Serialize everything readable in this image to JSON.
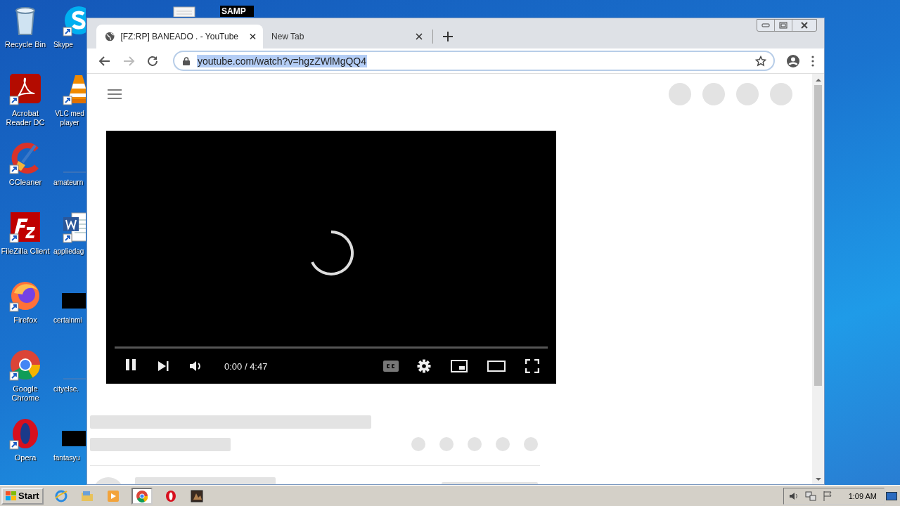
{
  "desktop": {
    "icons": [
      {
        "label": "Recycle Bin",
        "kind": "recycle",
        "shortcut": false
      },
      {
        "label": "Acrobat Reader DC",
        "kind": "acrobat",
        "shortcut": true
      },
      {
        "label": "CCleaner",
        "kind": "ccleaner",
        "shortcut": true
      },
      {
        "label": "FileZilla Client",
        "kind": "filezilla",
        "shortcut": true
      },
      {
        "label": "Firefox",
        "kind": "firefox",
        "shortcut": true
      },
      {
        "label": "Google Chrome",
        "kind": "chrome",
        "shortcut": true
      },
      {
        "label": "Opera",
        "kind": "opera",
        "shortcut": true
      }
    ],
    "partly_hidden_icons": [
      {
        "label": "Skype",
        "kind": "skype",
        "shortcut": true
      },
      {
        "label": "VLC med player",
        "kind": "vlc",
        "shortcut": true
      },
      {
        "label": "amateurn",
        "kind": "blank",
        "shortcut": false
      },
      {
        "label": "appliedag",
        "kind": "word",
        "shortcut": true
      },
      {
        "label": "certainmi",
        "kind": "redacted",
        "shortcut": false
      },
      {
        "label": "cityelse.",
        "kind": "blank",
        "shortcut": false
      },
      {
        "label": "fantasyu",
        "kind": "redacted",
        "shortcut": false
      }
    ],
    "top_icons": [
      {
        "kind": "document"
      },
      {
        "kind": "samp",
        "text": "SAMP"
      }
    ]
  },
  "browser": {
    "tabs": [
      {
        "title": "[FZ:RP] BANEADO . - YouTube",
        "selected": true
      },
      {
        "title": "New Tab",
        "selected": false
      }
    ],
    "address": {
      "value": "youtube.com/watch?v=hgzZWlMgQQ4",
      "selected": true
    },
    "forward_disabled": true,
    "player": {
      "loading": true,
      "playing": true,
      "time": "0:00 / 4:47",
      "level": 0
    }
  },
  "taskbar": {
    "start": "Start",
    "apps": [
      {
        "kind": "ie",
        "active": false
      },
      {
        "kind": "folder",
        "active": false
      },
      {
        "kind": "media",
        "active": false
      },
      {
        "kind": "chrome",
        "active": true
      },
      {
        "kind": "opera",
        "active": false
      },
      {
        "kind": "app",
        "active": false
      }
    ],
    "clock": "1:09 AM"
  }
}
